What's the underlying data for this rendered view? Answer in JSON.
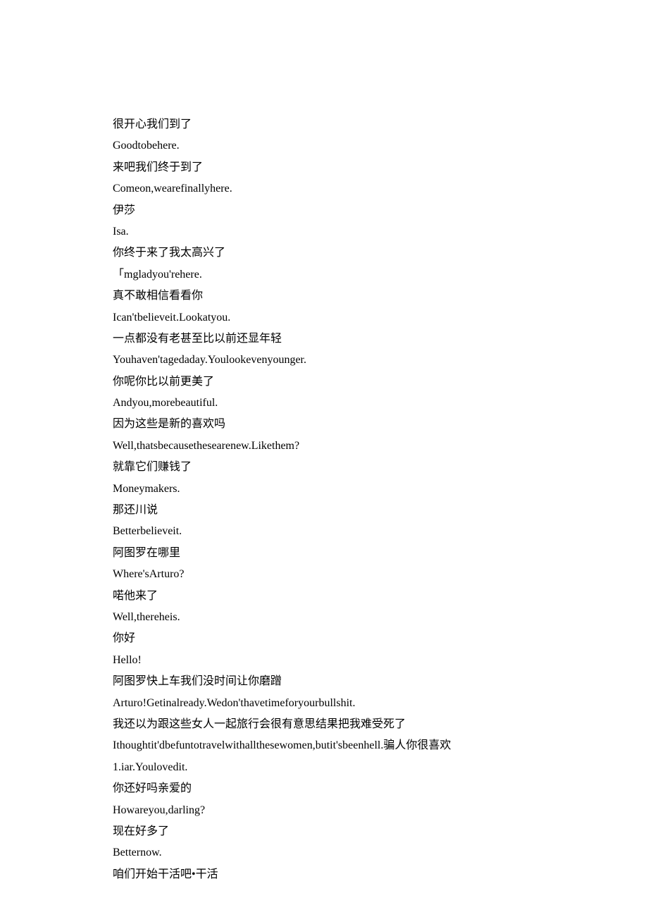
{
  "lines": [
    "很开心我们到了",
    "Goodtobehere.",
    "来吧我们终于到了",
    "Comeon,wearefinallyhere.",
    "伊莎",
    "Isa.",
    "你终于来了我太高兴了",
    "「mgladyou'rehere.",
    "真不敢相信看看你",
    "Ican'tbelieveit.Lookatyou.",
    "一点都没有老甚至比以前还显年轻",
    "Youhaven'tagedaday.Youlookevenyounger.",
    "你呢你比以前更美了",
    "Andyou,morebeautiful.",
    "因为这些是新的喜欢吗",
    "Well,thatsbecausethesearenew.Likethem?",
    "就靠它们赚钱了",
    "Moneymakers.",
    "那还川说",
    "Betterbelieveit.",
    "阿图罗在哪里",
    "Where'sArturo?",
    "喏他来了",
    "Well,thereheis.",
    "你好",
    "Hello!",
    "阿图罗快上车我们没时间让你磨蹭",
    "Arturo!Getinalready.Wedon'thavetimeforyourbullshit.",
    "我还以为跟这些女人一起旅行会很有意思结果把我难受死了",
    "Ithoughtit'dbefuntotravelwithallthesewomen,butit'sbeenhell.骗人你很喜欢",
    "1.iar.Youlovedit.",
    "你还好吗亲爱的",
    "Howareyou,darling?",
    "现在好多了",
    "Betternow.",
    "咱们开始干活吧•干活"
  ]
}
